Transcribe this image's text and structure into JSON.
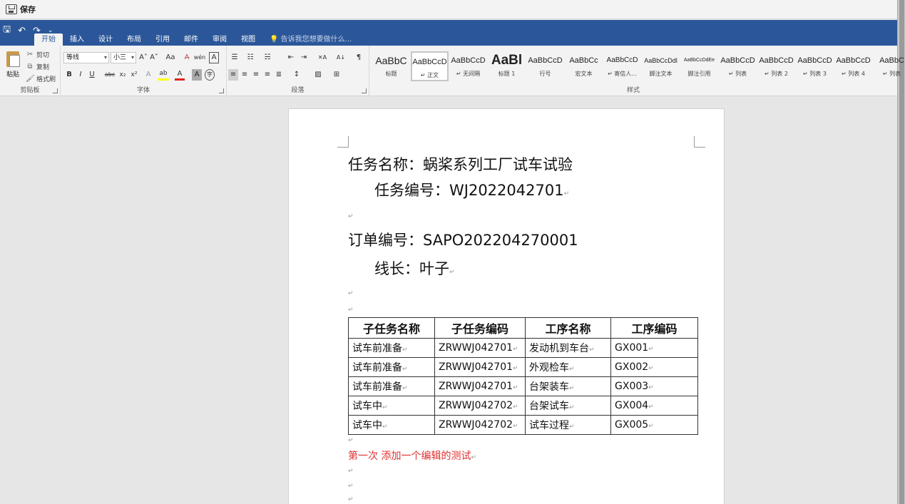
{
  "savebar": {
    "label": "保存"
  },
  "qat": {
    "save": "🖫",
    "undo": "↶",
    "redo": "↷",
    "more": "⌄"
  },
  "tabs": [
    "开始",
    "插入",
    "设计",
    "布局",
    "引用",
    "邮件",
    "审阅",
    "视图"
  ],
  "tell_me": "告诉我您想要做什么...",
  "ribbon": {
    "clipboard": {
      "paste": "粘贴",
      "cut": "剪切",
      "copy": "复制",
      "format_painter": "格式刷",
      "group": "剪贴板"
    },
    "font": {
      "family": "等线",
      "size": "小三",
      "group": "字体",
      "grow": "A˄",
      "shrink": "A˅",
      "case": "Aa",
      "clear": "A̶",
      "phonetic": "wén",
      "border": "A",
      "bold": "B",
      "italic": "I",
      "underline": "U",
      "strike": "abc",
      "sub": "x₂",
      "sup": "x²",
      "effects": "A",
      "highlight": "ab",
      "color": "A",
      "shade": "A",
      "enclose": "字"
    },
    "paragraph": {
      "group": "段落",
      "bullets": "☰",
      "numbering": "☷",
      "multilevel": "☵",
      "dec_indent": "⇤",
      "inc_indent": "⇥",
      "cn_layout": "✕A",
      "sort": "A↓",
      "marks": "¶",
      "align_left": "≡",
      "center": "≡",
      "align_right": "≡",
      "justify": "≡",
      "distributed": "≣",
      "spacing": "↕",
      "shading": "▨",
      "borders": "⊞"
    },
    "styles": {
      "group": "样式",
      "items": [
        {
          "preview": "AaBbC",
          "name": "标题"
        },
        {
          "preview": "AaBbCcD",
          "name": "↵ 正文"
        },
        {
          "preview": "AaBbCcD",
          "name": "↵ 无间隔"
        },
        {
          "preview": "AaBl",
          "name": "标题 1"
        },
        {
          "preview": "AaBbCcD",
          "name": "行号"
        },
        {
          "preview": "AaBbCc",
          "name": "宏文本"
        },
        {
          "preview": "AaBbCcD",
          "name": "↵ 寄信人..."
        },
        {
          "preview": "AaBbCcDdl",
          "name": "脚注文本"
        },
        {
          "preview": "AaBbCcDdEe",
          "name": "脚注引用"
        },
        {
          "preview": "AaBbCcD",
          "name": "↵ 列表"
        },
        {
          "preview": "AaBbCcD",
          "name": "↵ 列表 2"
        },
        {
          "preview": "AaBbCcD",
          "name": "↵ 列表 3"
        },
        {
          "preview": "AaBbCcD",
          "name": "↵ 列表 4"
        },
        {
          "preview": "AaBbC",
          "name": "↵ 列表"
        }
      ]
    }
  },
  "document": {
    "task_name": "任务名称：蜗桨系列工厂试车试验",
    "task_no": "任务编号：WJ2022042701",
    "order_no": "订单编号：SAPO202204270001",
    "line_leader": "线长：叶子",
    "para_mark": "↵",
    "table": {
      "headers": [
        "子任务名称",
        "子任务编码",
        "工序名称",
        "工序编码"
      ],
      "rows": [
        [
          "试车前准备",
          "ZRWWJ042701",
          "发动机到车台",
          "GX001"
        ],
        [
          "试车前准备",
          "ZRWWJ042701",
          "外观检车",
          "GX002"
        ],
        [
          "试车前准备",
          "ZRWWJ042701",
          "台架装车",
          "GX003"
        ],
        [
          "试车中",
          "ZRWWJ042702",
          "台架试车",
          "GX004"
        ],
        [
          "试车中",
          "ZRWWJ042702",
          "试车过程",
          "GX005"
        ]
      ]
    },
    "red_note": "第一次  添加一个编辑的测试"
  }
}
